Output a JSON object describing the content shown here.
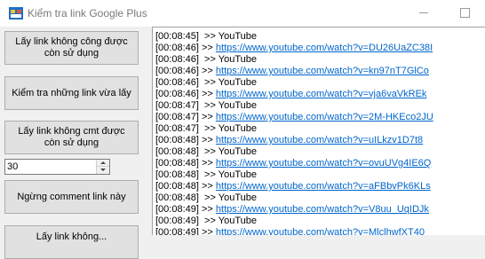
{
  "window": {
    "title": "Kiểm tra link Google Plus",
    "app_icon": "winforms-app-icon",
    "controls": [
      "minimize-icon",
      "maximize-icon"
    ]
  },
  "sidebar": {
    "btn_get_unused": "Lấy link không công được còn sử dụng",
    "btn_check_recent": "Kiểm tra những link vừa lấy",
    "btn_get_unused_cmt": "Lấy link không cmt được còn sử dụng",
    "count_value": "30",
    "btn_stop_comment": "Ngừng comment link này",
    "btn_partial": "Lấy link không..."
  },
  "log": {
    "lines": [
      {
        "time": "[00:08:45]",
        "sep": "  >> ",
        "text": "YouTube",
        "link": false
      },
      {
        "time": "[00:08:46]",
        "sep": " >> ",
        "text": "https://www.youtube.com/watch?v=DU26UaZC38I",
        "link": true
      },
      {
        "time": "[00:08:46]",
        "sep": "  >> ",
        "text": "YouTube",
        "link": false
      },
      {
        "time": "[00:08:46]",
        "sep": " >> ",
        "text": "https://www.youtube.com/watch?v=kn97nT7GlCo",
        "link": true
      },
      {
        "time": "[00:08:46]",
        "sep": "  >> ",
        "text": "YouTube",
        "link": false
      },
      {
        "time": "[00:08:46]",
        "sep": " >> ",
        "text": "https://www.youtube.com/watch?v=vja6vaVkREk",
        "link": true
      },
      {
        "time": "[00:08:47]",
        "sep": "  >> ",
        "text": "YouTube",
        "link": false
      },
      {
        "time": "[00:08:47]",
        "sep": " >> ",
        "text": "https://www.youtube.com/watch?v=2M-HKEco2JU",
        "link": true
      },
      {
        "time": "[00:08:47]",
        "sep": "  >> ",
        "text": "YouTube",
        "link": false
      },
      {
        "time": "[00:08:48]",
        "sep": " >> ",
        "text": "https://www.youtube.com/watch?v=uILkzv1D7t8",
        "link": true
      },
      {
        "time": "[00:08:48]",
        "sep": "  >> ",
        "text": "YouTube",
        "link": false
      },
      {
        "time": "[00:08:48]",
        "sep": " >> ",
        "text": "https://www.youtube.com/watch?v=ovuUVg4IE6Q",
        "link": true
      },
      {
        "time": "[00:08:48]",
        "sep": "  >> ",
        "text": "YouTube",
        "link": false
      },
      {
        "time": "[00:08:48]",
        "sep": " >> ",
        "text": "https://www.youtube.com/watch?v=aFBbvPk6KLs",
        "link": true
      },
      {
        "time": "[00:08:48]",
        "sep": "  >> ",
        "text": "YouTube",
        "link": false
      },
      {
        "time": "[00:08:49]",
        "sep": " >> ",
        "text": "https://www.youtube.com/watch?v=V8uu_UqIDJk",
        "link": true
      },
      {
        "time": "[00:08:49]",
        "sep": "  >> ",
        "text": "YouTube",
        "link": false
      },
      {
        "time": "[00:08:49]",
        "sep": " >> ",
        "text": "https://www.youtube.com/watch?v=MlclhwfXT40",
        "link": true
      }
    ]
  },
  "colors": {
    "link": "#0066cc",
    "button_face": "#e1e1e1",
    "window_bg": "#f0f0f0"
  }
}
